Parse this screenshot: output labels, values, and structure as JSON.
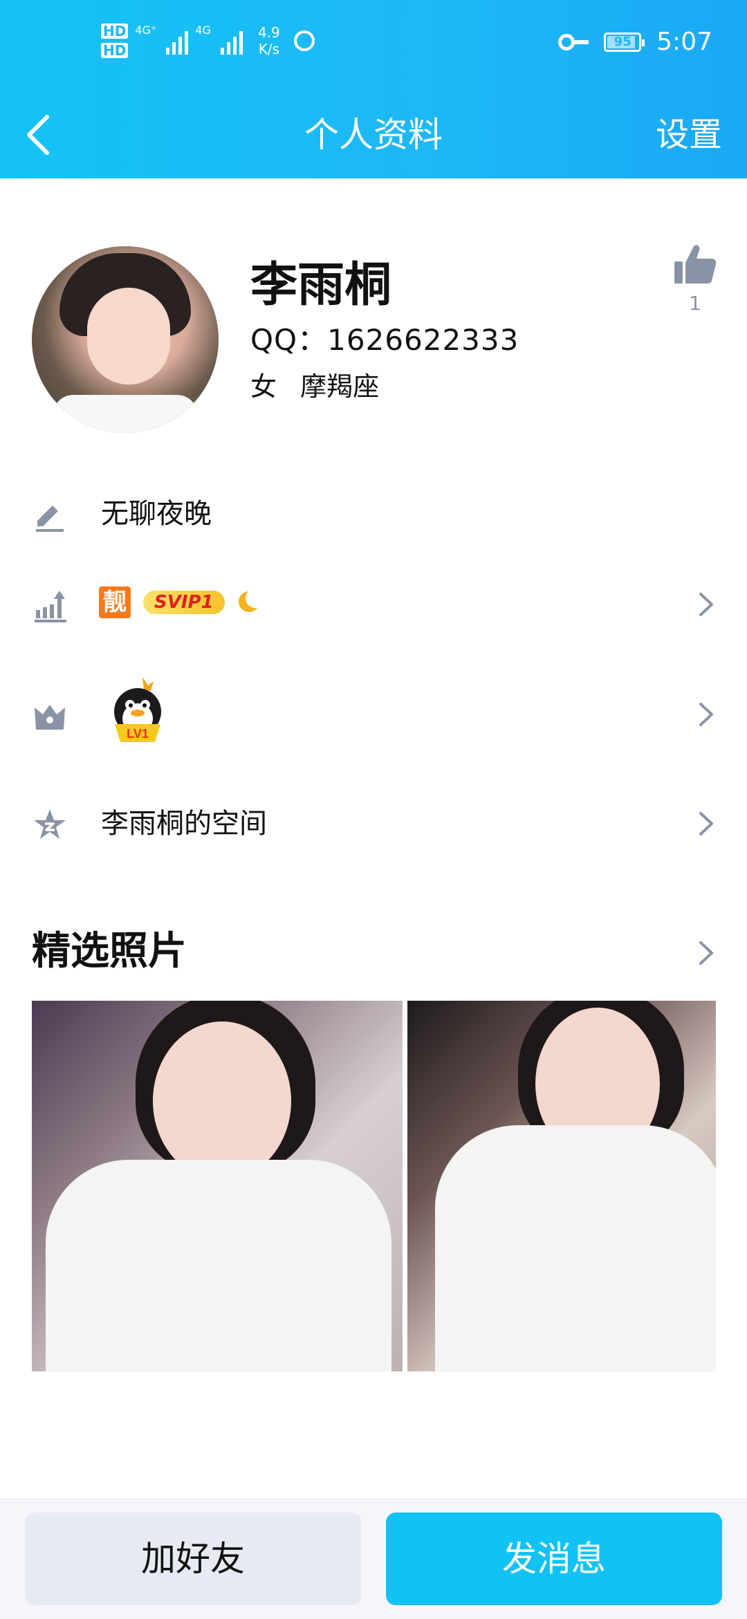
{
  "status_bar": {
    "hd1": "HD",
    "hd2": "HD",
    "network1": "4G⁺",
    "network2": "4G",
    "speed_value": "4.9",
    "speed_unit": "K/s",
    "battery": "95",
    "time": "5:07"
  },
  "nav": {
    "title": "个人资料",
    "settings": "设置"
  },
  "profile": {
    "name": "李雨桐",
    "qq": "QQ：1626622333",
    "gender": "女",
    "zodiac": "摩羯座",
    "like_count": "1"
  },
  "rows": {
    "signature": "无聊夜晚",
    "badges": {
      "liang": "靓",
      "svip": "SVIP1"
    },
    "level_badge": "LV1",
    "space": "李雨桐的空间"
  },
  "photos": {
    "title": "精选照片"
  },
  "buttons": {
    "add_friend": "加好友",
    "send_message": "发消息"
  },
  "colors": {
    "header_start": "#14c3f4",
    "header_end": "#1aa9f5",
    "primary_button": "#12c2f5",
    "secondary_button": "#e8eaf3",
    "icon_gray": "#8a93a6"
  },
  "icons": {
    "back": "back-arrow-icon",
    "like": "thumbs-up-icon",
    "signature": "pencil-icon",
    "vip": "growth-chart-icon",
    "level": "crown-icon",
    "space": "qzone-star-icon",
    "chevron": "chevron-right-icon"
  }
}
